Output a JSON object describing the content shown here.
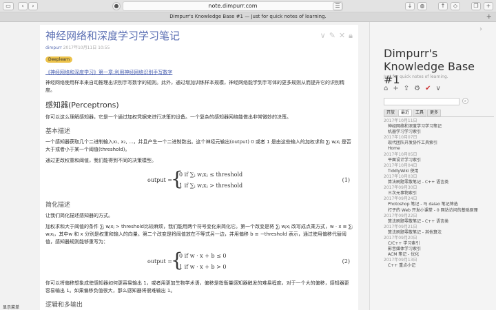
{
  "browser": {
    "url": "note.dimpurr.com",
    "tab_title": "Dimpurr's Knowledge Base #1 — Just for quick notes of learning."
  },
  "tiddler": {
    "title": "神经网络和深度学习学习笔记",
    "author": "dimpurr",
    "date": "2017年10月11日 10:55",
    "tag": "Deeplearn",
    "chapter_link": "《神经网络和深度学习》第一章:利用神经网络识别手写数字",
    "intro": "神经网络使用样本来自动推理出识别手写数字的规则。此外，通过增加训练样本规模，神经网络能学到手写体的更多规则从而提升它的识别精度。",
    "h_perceptron": "感知器(Perceptrons)",
    "p_perceptron": "你可以这么理解感知器，它是一个通过加权凭据来进行决策的设备。一个复杂的感知器网络能做出非常微妙的决策。",
    "h_basic": "基本描述",
    "p_basic": "一个感知器获取几个二进制输入x₁, x₂, ...，并且产生一个二进制数出。这个神经元输出(output) 0 或者 1 是由这些输入的加权求和 ∑ⱼ wⱼxⱼ 是否大于或者小于某一个阈值(threshold)。",
    "p_decide": "通过更改权重和阈值，我们能得到不同的决策模型。",
    "eq1": {
      "lhs": "output =",
      "r1": "0    if  ∑ⱼ wⱼxⱼ ≤  threshold",
      "r2": "1    if  ∑ⱼ wⱼxⱼ >  threshold",
      "num": "(1)"
    },
    "h_simple": "简化描述",
    "p_simple": "让我们简化描述感知器的方式。",
    "p_simple2": "加权求和大于阈值的条件 ∑ⱼ wⱼxⱼ > threshold比较麻烦，我们能用两个符号变化来简化它。第一个改变是将 ∑ⱼ wⱼxⱼ 改写成点乘方式，w · x ≡ ∑ⱼ wⱼxⱼ，其中w 和 x 分别是权重和输入的向量。第二个改变是将阈值放在不等式另一边，并用偏移 b ≡ −threshold 表示，通过使用偏移代替阈值，感知器规则能够重写为：",
    "eq2": {
      "lhs": "output =",
      "r1": "0    if w · x + b ≤ 0",
      "r2": "1    if w · x + b > 0",
      "num": "(2)"
    },
    "p_bias": "你可以将偏移想象成使感知器如何更容易输出 1，或者用更加生物学术语，偏移是指衡量感知器触发的难易程度。对于一个大的偏移，感知器更容易输出 1。如果偏移负值很大，那么感知器将很难输出 1。",
    "h_logic": "逻辑和多输出"
  },
  "sidebar": {
    "title": "Dimpurr's Knowledge Base #1",
    "subtitle": "Just for quick notes of learning.",
    "tabs": [
      "开放",
      "最近",
      "工具",
      "更多"
    ],
    "recent": [
      {
        "d": "2017年10月11日"
      },
      {
        "e": "神经网络和深度学习学习笔记"
      },
      {
        "e": "机器学习学习索引"
      },
      {
        "d": "2017年10月07日"
      },
      {
        "e": "现代团队开发协作工具索引"
      },
      {
        "e": "Home"
      },
      {
        "d": "2017年10月05日"
      },
      {
        "e": "平面设计学习索引"
      },
      {
        "d": "2017年10月04日"
      },
      {
        "e": "TiddlyWiki 使用"
      },
      {
        "d": "2017年10月03日"
      },
      {
        "e": "算法刷题零散笔记 - C++ 语言类"
      },
      {
        "d": "2017年09月30日"
      },
      {
        "e": "三次元事物索引"
      },
      {
        "d": "2017年09月24日"
      },
      {
        "e": "Photoshop 笔记 - 马 daiao 笔记筛选"
      },
      {
        "e": "打子的 Web 开发小课堂 - 0 网站访问的基础原理"
      },
      {
        "d": "2017年09月22日"
      },
      {
        "e": "算法刷题零散笔记 - C++ 语言类"
      },
      {
        "d": "2017年09月21日"
      },
      {
        "e": "算法刷题零散笔记 - 其他算法"
      },
      {
        "d": "2017年09月20日"
      },
      {
        "e": "C/C++ 学习索引"
      },
      {
        "e": "影音媒体学习索引"
      },
      {
        "e": "ACM 笔记 - 优化"
      },
      {
        "d": "2017年09月13日"
      },
      {
        "e": "C++ 重点小记"
      }
    ]
  },
  "status_text": "显示菜单"
}
